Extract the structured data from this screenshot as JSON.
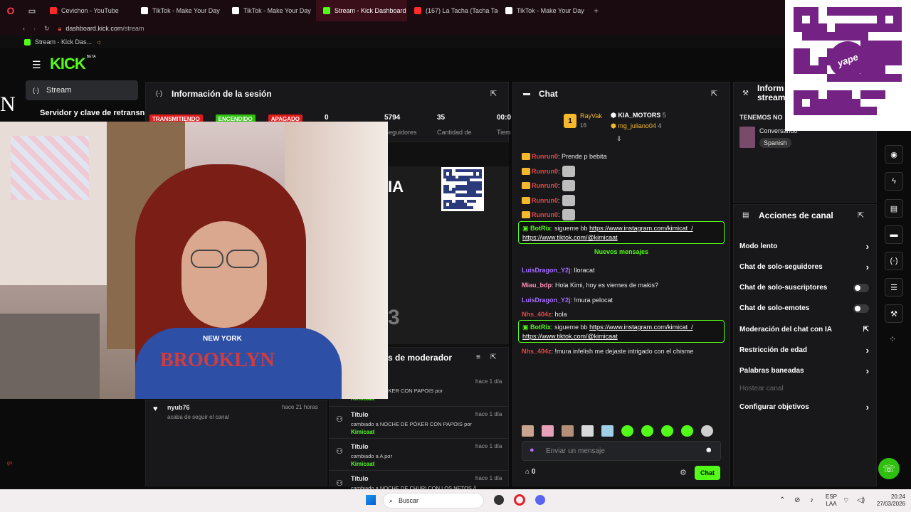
{
  "browser": {
    "tabs": [
      {
        "label": "Cevichon - YouTube",
        "color": "#ff2a2a"
      },
      {
        "label": "TikTok - Make Your Day",
        "color": "#ffffff"
      },
      {
        "label": "TikTok - Make Your Day",
        "color": "#ffffff"
      },
      {
        "label": "Stream - Kick Dashboard",
        "color": "#53fc18"
      },
      {
        "label": "(167) La Tacha (Tacha Tac",
        "color": "#ff2a2a"
      },
      {
        "label": "TikTok - Make Your Day",
        "color": "#ffffff"
      }
    ],
    "url_domain": "dashboard.kick.com",
    "url_path": "/stream",
    "bookmark": "Stream - Kick Das..."
  },
  "dashboard": {
    "logo": "KICK",
    "logo_beta": "BETA",
    "nav_active": "Stream",
    "server_key_label": "Servidor y clave de retransn",
    "brand_color": "#53fc18"
  },
  "session": {
    "title": "Información de la sesión",
    "badges": [
      {
        "label": "TRANSMITIENDO",
        "color": "#e01a1a"
      },
      {
        "label": "ENCENDIDO",
        "color": "#2fbf0f"
      },
      {
        "label": "APAGADO",
        "color": "#e01a1a"
      }
    ],
    "stats": [
      {
        "value": "0",
        "label": ""
      },
      {
        "value": "5794",
        "label": "Seguidores"
      },
      {
        "value": "35",
        "label": "Cantidad de"
      },
      {
        "value": "00:0",
        "label": "Tiem"
      }
    ]
  },
  "activity": {
    "follow_user": "nyub76",
    "follow_text": "acaba de seguir el canal",
    "follow_time": "hace 21 horas"
  },
  "mod_actions": {
    "title": "s de moderador",
    "items": [
      {
        "heading": "",
        "desc": "NOCHE DE PÓKER CON PAPOIS por",
        "by": "Kimicaat",
        "time": "hace 1 día"
      },
      {
        "heading": "Título",
        "desc": "cambiado a NOCHE DE PÓKER CON PAPOIS por",
        "by": "Kimicaat",
        "time": "hace 1 día"
      },
      {
        "heading": "Título",
        "desc": "cambiado a A por",
        "by": "Kimicaat",
        "time": "hace 1 día"
      },
      {
        "heading": "Título",
        "desc": "cambiado a NOCHE DE CHURI CON LOS NETOS //",
        "by": "",
        "time": "hace 1 día"
      }
    ]
  },
  "chat": {
    "title": "Chat",
    "top_gifters": [
      {
        "name": "RayVak",
        "count": "16"
      },
      {
        "name": "KIA_MOTORS",
        "count": "5"
      },
      {
        "name": "mg_juliano04",
        "count": "4"
      }
    ],
    "top_rank": "1",
    "messages": [
      {
        "user": "Runrun0",
        "color": "#e04848",
        "text": ": Prende p bebita",
        "crown": true,
        "emote": false
      },
      {
        "user": "Runrun0",
        "color": "#e04848",
        "text": ":",
        "crown": true,
        "emote": true
      },
      {
        "user": "Runrun0",
        "color": "#e04848",
        "text": ":",
        "crown": true,
        "emote": true
      },
      {
        "user": "Runrun0",
        "color": "#e04848",
        "text": ":",
        "crown": true,
        "emote": true
      },
      {
        "user": "Runrun0",
        "color": "#e04848",
        "text": ":",
        "crown": true,
        "emote": true
      }
    ],
    "bot1": {
      "user": "BotRix",
      "text": ": sigueme bb ",
      "link1": "https://www.instagram.com/kimicat_/",
      "link2": "https://www.tiktok.com/@kimicaat"
    },
    "new_messages_label": "Nuevos mensajes",
    "messages2": [
      {
        "user": "LuisDragon_Y2j",
        "color": "#a66cff",
        "text": ": lloracat"
      },
      {
        "user": "Miau_bdp",
        "color": "#ff8fb3",
        "text": ": Hola Kimi, hoy es viernes de makis?"
      },
      {
        "user": "LuisDragon_Y2j",
        "color": "#a66cff",
        "text": ": !mura pelocat"
      },
      {
        "user": "Nhs_404z",
        "color": "#e04848",
        "text": ": hola"
      }
    ],
    "bot2": {
      "user": "BotRix",
      "text": ": sigueme bb ",
      "link1": "https://www.instagram.com/kimicat_/",
      "link2": "https://www.tiktok.com/@kimicaat"
    },
    "last": {
      "user": "Nhs_404z",
      "color": "#e04848",
      "text": ": !mura infelish me dejaste intrigado con el chisme"
    },
    "input_placeholder": "Enviar un mensaje",
    "points": "0",
    "send_label": "Chat"
  },
  "stream_info": {
    "title_line1": "Inform",
    "title_line2": "stream",
    "label": "TENEMOS NO",
    "category": "Conversando",
    "language": "Spanish"
  },
  "channel_actions": {
    "title": "Acciones de canal",
    "items": [
      {
        "label": "Modo lento",
        "control": "chevron"
      },
      {
        "label": "Chat de solo-seguidores",
        "control": "chevron"
      },
      {
        "label": "Chat de solo-suscriptores",
        "control": "toggle"
      },
      {
        "label": "Chat de solo-emotes",
        "control": "toggle"
      },
      {
        "label": "Moderación del chat con IA",
        "control": "external"
      },
      {
        "label": "Restricción de edad",
        "control": "chevron"
      },
      {
        "label": "Palabras baneadas",
        "control": "chevron"
      }
    ],
    "disabled_item": "Hostear canal",
    "last_item": "Configurar objetivos"
  },
  "overlay": {
    "qr_brand": "yape",
    "webcam_shirt_text": "NEW YORK",
    "webcam_shirt_big": "BROOKLYN"
  },
  "taskbar": {
    "search_label": "Buscar",
    "lang_top": "ESP",
    "lang_bottom": "LAA",
    "time": "20:24",
    "date": "27/03/2026"
  }
}
